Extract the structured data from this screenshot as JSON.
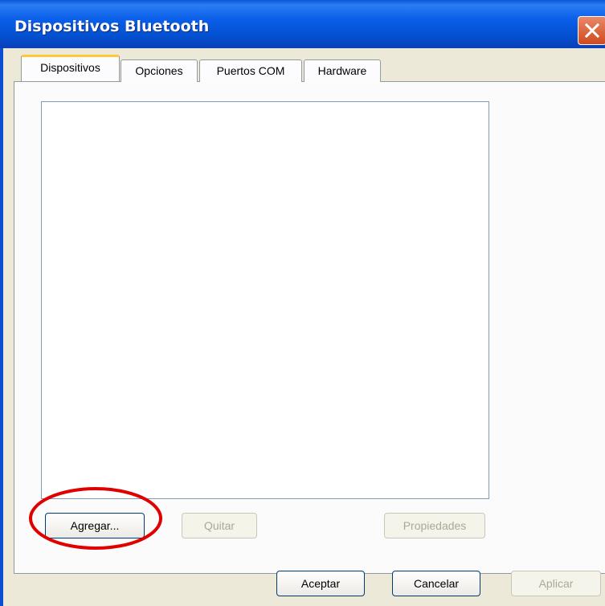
{
  "window": {
    "title": "Dispositivos Bluetooth"
  },
  "tabs": [
    {
      "label": "Dispositivos",
      "active": true
    },
    {
      "label": "Opciones",
      "active": false
    },
    {
      "label": "Puertos COM",
      "active": false
    },
    {
      "label": "Hardware",
      "active": false
    }
  ],
  "device_list": {
    "items": []
  },
  "panel_buttons": {
    "add": {
      "label": "Agregar...",
      "enabled": true
    },
    "remove": {
      "label": "Quitar",
      "enabled": false
    },
    "properties": {
      "label": "Propiedades",
      "enabled": false
    }
  },
  "dialog_buttons": {
    "ok": {
      "label": "Aceptar",
      "enabled": true
    },
    "cancel": {
      "label": "Cancelar",
      "enabled": true
    },
    "apply": {
      "label": "Aplicar",
      "enabled": false
    }
  },
  "colors": {
    "titlebar": "#0a5ee8",
    "dialog_bg": "#ece9d8",
    "active_tab_accent": "#ffc83c",
    "highlight_ellipse": "#e00000"
  },
  "icons": {
    "close": "close-icon"
  }
}
